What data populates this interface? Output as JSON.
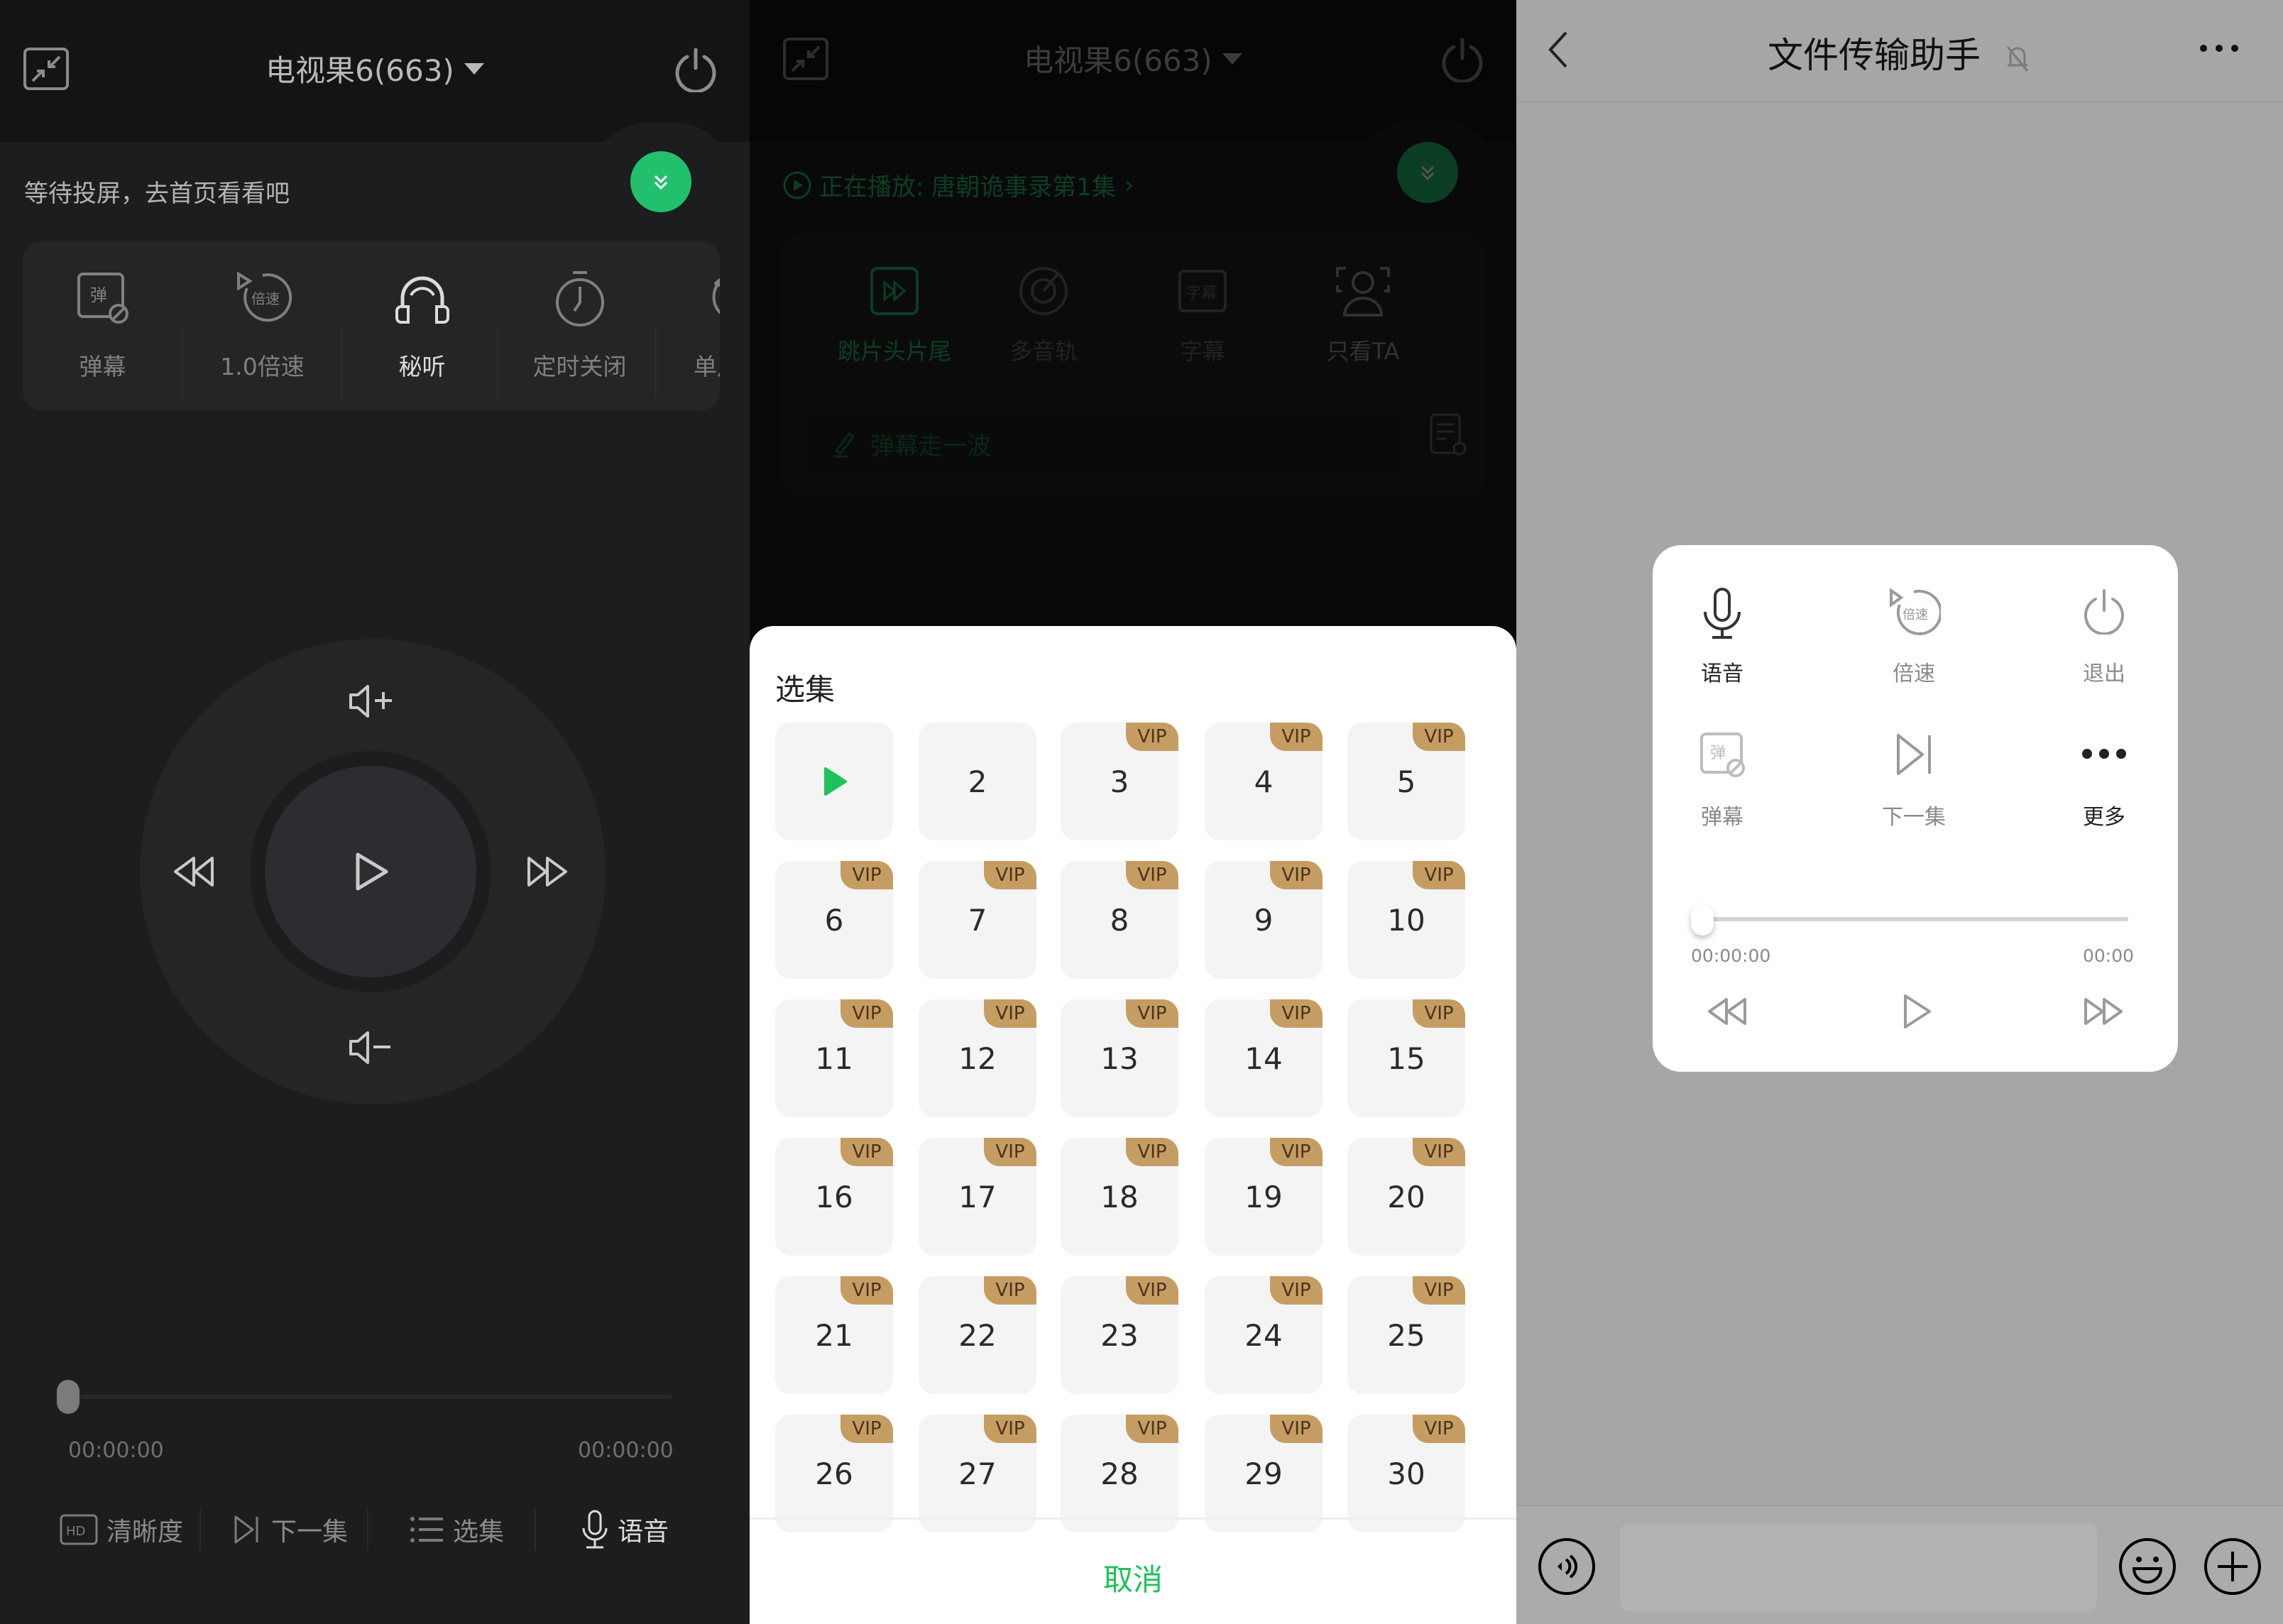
{
  "left_panel": {
    "header": {
      "device_title": "电视果6(663)",
      "minimize_icon": "shrink-arrows-icon",
      "power_icon": "power-icon"
    },
    "status_text": "等待投屏，去首页看看吧",
    "collapse_icon": "double-chevron-down-icon",
    "chips": [
      {
        "label": "弹幕",
        "icon": "danmaku-off-icon",
        "active": false
      },
      {
        "label": "1.0倍速",
        "icon": "speed-icon",
        "active": false
      },
      {
        "label": "秘听",
        "icon": "headphones-icon",
        "active": true
      },
      {
        "label": "定时关闭",
        "icon": "timer-icon",
        "active": false
      },
      {
        "label": "单片",
        "icon": "repeat-one-icon",
        "active": false
      }
    ],
    "remote": {
      "volume_up": "volume-up-icon",
      "volume_down": "volume-down-icon",
      "rewind": "rewind-icon",
      "forward": "fast-forward-icon",
      "play": "play-icon"
    },
    "progress": {
      "value": 0,
      "current_time": "00:00:00",
      "total_time": "00:00:00"
    },
    "bottom_actions": [
      {
        "label": "清晰度",
        "icon": "hd-icon"
      },
      {
        "label": "下一集",
        "icon": "next-episode-icon"
      },
      {
        "label": "选集",
        "icon": "list-icon"
      },
      {
        "label": "语音",
        "icon": "microphone-icon"
      }
    ]
  },
  "middle_panel": {
    "header": {
      "device_title": "电视果6(663)"
    },
    "now_playing": "正在播放: 唐朝诡事录第1集",
    "features": [
      {
        "label": "跳片头片尾",
        "icon": "skip-intro-icon",
        "active": true
      },
      {
        "label": "多音轨",
        "icon": "audio-track-icon",
        "active": false
      },
      {
        "label": "字幕",
        "icon": "subtitle-icon",
        "active": false
      },
      {
        "label": "只看TA",
        "icon": "focus-person-icon",
        "active": false
      }
    ],
    "danmaku_placeholder": "弹幕走一波",
    "episode_sheet": {
      "title": "选集",
      "vip_label": "VIP",
      "current_episode": 1,
      "episodes": [
        {
          "n": "1",
          "vip": false,
          "playing": true
        },
        {
          "n": "2",
          "vip": false
        },
        {
          "n": "3",
          "vip": true
        },
        {
          "n": "4",
          "vip": true
        },
        {
          "n": "5",
          "vip": true
        },
        {
          "n": "6",
          "vip": true
        },
        {
          "n": "7",
          "vip": true
        },
        {
          "n": "8",
          "vip": true
        },
        {
          "n": "9",
          "vip": true
        },
        {
          "n": "10",
          "vip": true
        },
        {
          "n": "11",
          "vip": true
        },
        {
          "n": "12",
          "vip": true
        },
        {
          "n": "13",
          "vip": true
        },
        {
          "n": "14",
          "vip": true
        },
        {
          "n": "15",
          "vip": true
        },
        {
          "n": "16",
          "vip": true
        },
        {
          "n": "17",
          "vip": true
        },
        {
          "n": "18",
          "vip": true
        },
        {
          "n": "19",
          "vip": true
        },
        {
          "n": "20",
          "vip": true
        },
        {
          "n": "21",
          "vip": true
        },
        {
          "n": "22",
          "vip": true
        },
        {
          "n": "23",
          "vip": true
        },
        {
          "n": "24",
          "vip": true
        },
        {
          "n": "25",
          "vip": true
        },
        {
          "n": "26",
          "vip": true
        },
        {
          "n": "27",
          "vip": true
        },
        {
          "n": "28",
          "vip": true
        },
        {
          "n": "29",
          "vip": true
        },
        {
          "n": "30",
          "vip": true
        }
      ],
      "cancel_label": "取消"
    }
  },
  "right_panel": {
    "header": {
      "title": "文件传输助手",
      "back_icon": "back-chevron-icon",
      "mute_icon": "bell-muted-icon",
      "more_icon": "more-dots-icon"
    },
    "card": {
      "items": [
        {
          "label": "语音",
          "icon": "microphone-icon",
          "emphasis": true
        },
        {
          "label": "倍速",
          "icon": "speed-icon",
          "emphasis": false
        },
        {
          "label": "退出",
          "icon": "power-icon",
          "emphasis": false
        },
        {
          "label": "弹幕",
          "icon": "danmaku-off-icon",
          "emphasis": false
        },
        {
          "label": "下一集",
          "icon": "next-episode-icon",
          "emphasis": false
        },
        {
          "label": "更多",
          "icon": "more-dots-icon",
          "emphasis": true
        }
      ],
      "progress": {
        "value": 0,
        "current_time": "00:00:00",
        "total_time": "00:00"
      }
    },
    "input_bar": {
      "voice_icon": "voice-input-icon",
      "emoji_icon": "emoji-icon",
      "plus_icon": "plus-circle-icon",
      "text_value": ""
    }
  },
  "colors": {
    "accent_green": "#22c06d",
    "cancel_green": "#1ec25b",
    "vip_gold": "#c59d63"
  }
}
